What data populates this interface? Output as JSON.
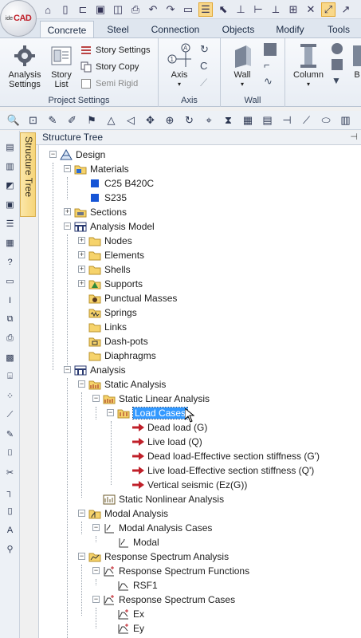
{
  "app": {
    "logo_text": "CAD",
    "logo_prefix": "ide"
  },
  "colors": {
    "accent": "#3399ff",
    "folder": "#f6d36b",
    "arrow": "#c0202a",
    "ribbon_tab_active": "#f5f7fa"
  },
  "quick_access": [
    {
      "icon": "home-icon"
    },
    {
      "icon": "new-file-icon"
    },
    {
      "icon": "open-folder-icon"
    },
    {
      "icon": "save-icon"
    },
    {
      "icon": "save-copy-icon"
    },
    {
      "icon": "print-icon"
    },
    {
      "icon": "undo-icon"
    },
    {
      "icon": "redo-icon"
    },
    {
      "icon": "window-icon"
    },
    {
      "icon": "layers-icon"
    },
    {
      "icon": "select-icon"
    },
    {
      "icon": "dimension-icon"
    },
    {
      "icon": "align-icon"
    },
    {
      "icon": "axis-icon"
    },
    {
      "icon": "grid-icon"
    },
    {
      "icon": "snap-icon"
    },
    {
      "icon": "move-icon"
    },
    {
      "icon": "more-icon"
    }
  ],
  "ribbon_tabs": [
    "Concrete",
    "Steel",
    "Connection",
    "Objects",
    "Modify",
    "Tools"
  ],
  "ribbon": {
    "project_settings": {
      "label": "Project Settings",
      "analysis_settings": "Analysis\nSettings",
      "story_list": "Story\nList",
      "story_settings": "Story Settings",
      "story_copy": "Story Copy",
      "semi_rigid": "Semi Rigid"
    },
    "axis": {
      "label": "Axis",
      "axis_button": "Axis"
    },
    "wall": {
      "label": "Wall",
      "wall_button": "Wall"
    },
    "column": {
      "column_button": "Column",
      "b_button": "B"
    }
  },
  "panel": {
    "title": "Structure Tree",
    "side_tab": "Structure Tree",
    "pin": "⊣"
  },
  "tree": {
    "design": "Design",
    "materials": "Materials",
    "mat1": "C25 B420C",
    "mat2": "S235",
    "sections": "Sections",
    "analysis_model": "Analysis Model",
    "nodes": "Nodes",
    "elements": "Elements",
    "shells": "Shells",
    "supports": "Supports",
    "punctual_masses": "Punctual Masses",
    "springs": "Springs",
    "links": "Links",
    "dash_pots": "Dash-pots",
    "diaphragms": "Diaphragms",
    "analysis": "Analysis",
    "static_analysis": "Static Analysis",
    "static_linear": "Static Linear Analysis",
    "load_cases": "Load Cases",
    "lc1": "Dead load (G)",
    "lc2": "Live load (Q)",
    "lc3": "Dead load-Effective section stiffness (G')",
    "lc4": "Live load-Effective section stiffness (Q')",
    "lc5": "Vertical seismic (Ez(G))",
    "static_nonlinear": "Static Nonlinear Analysis",
    "modal_analysis": "Modal Analysis",
    "modal_cases": "Modal Analysis Cases",
    "modal": "Modal",
    "response_spectrum": "Response Spectrum Analysis",
    "rs_functions": "Response Spectrum Functions",
    "rsf1": "RSF1",
    "rs_cases": "Response Spectrum Cases",
    "ex": "Ex",
    "ey": "Ey"
  }
}
